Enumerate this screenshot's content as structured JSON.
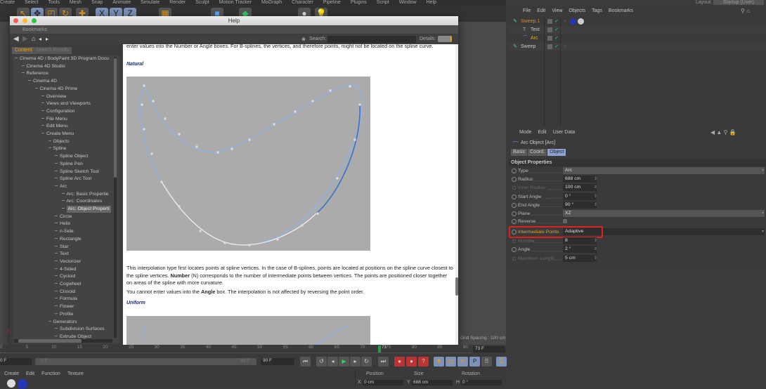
{
  "menubar": [
    "Create",
    "Select",
    "Tools",
    "Mesh",
    "Snap",
    "Animate",
    "Simulate",
    "Render",
    "Sculpt",
    "Motion Tracker",
    "MoGraph",
    "Character",
    "Pipeline",
    "Plugins",
    "Script",
    "Window",
    "Help"
  ],
  "layout": {
    "label": "Layout:",
    "value": "Startup (User)"
  },
  "help": {
    "title": "Help",
    "bookmarks": "Bookmarks",
    "search_label": "Search:",
    "search_value": "",
    "details_label": "Details:",
    "tabs": [
      "Content",
      "Search Results"
    ],
    "tree": [
      {
        "label": "Cinema 4D / BodyPaint 3D Program Docu",
        "level": 0
      },
      {
        "label": "Cinema 4D Studio",
        "level": 1
      },
      {
        "label": "Reference",
        "level": 1
      },
      {
        "label": "Cinema 4D",
        "level": 2
      },
      {
        "label": "Cinema 4D Prime",
        "level": 3
      },
      {
        "label": "Overview",
        "level": 4
      },
      {
        "label": "Views and Viewports",
        "level": 4
      },
      {
        "label": "Configuration",
        "level": 4
      },
      {
        "label": "File Menu",
        "level": 4
      },
      {
        "label": "Edit Menu",
        "level": 4
      },
      {
        "label": "Create Menu",
        "level": 4
      },
      {
        "label": "Objects",
        "level": 5
      },
      {
        "label": "Spline",
        "level": 5
      },
      {
        "label": "Spline Object",
        "level": 6
      },
      {
        "label": "Spline Pen",
        "level": 6
      },
      {
        "label": "Spline Sketch Tool",
        "level": 6
      },
      {
        "label": "Spline Arc Tool",
        "level": 6
      },
      {
        "label": "Arc",
        "level": 6
      },
      {
        "label": "Arc: Basic Propertie",
        "level": 7
      },
      {
        "label": "Arc: Coordinates",
        "level": 7
      },
      {
        "label": "Arc: Object Properti",
        "level": 7,
        "selected": true
      },
      {
        "label": "Circle",
        "level": 6
      },
      {
        "label": "Helix",
        "level": 6
      },
      {
        "label": "n-Side",
        "level": 6
      },
      {
        "label": "Rectangle",
        "level": 6
      },
      {
        "label": "Star",
        "level": 6
      },
      {
        "label": "Text",
        "level": 6
      },
      {
        "label": "Vectorizer",
        "level": 6
      },
      {
        "label": "4-Sided",
        "level": 6
      },
      {
        "label": "Cycloid",
        "level": 6
      },
      {
        "label": "Cogwheel",
        "level": 6
      },
      {
        "label": "Cissoid",
        "level": 6
      },
      {
        "label": "Formula",
        "level": 6
      },
      {
        "label": "Flower",
        "level": 6
      },
      {
        "label": "Profile",
        "level": 6
      },
      {
        "label": "Generators",
        "level": 5
      },
      {
        "label": "Subdivision Surfaces",
        "level": 6
      },
      {
        "label": "Extrude Object",
        "level": 6
      }
    ],
    "content": {
      "intro": "enter values into the Number or Angle boxes. For B-splines, the vertices, and therefore points, might not be located on the spline curve.",
      "natural_heading": "Natural",
      "para1_a": "This interpolation type first locates points at spline vertices. In the case of B-splines, points are located at positions on the spline curve closest to the spline vertices. ",
      "para1_bold": "Number",
      "para1_b": " (N) corresponds to the number of intermediate points between vertices. The points are positioned closer together on areas of the spline with more curvature.",
      "para2_a": "You cannot enter values into the ",
      "para2_bold": "Angle",
      "para2_b": " box. The interpolation is not affected by reversing the point order.",
      "uniform_heading": "Uniform"
    }
  },
  "object_manager": {
    "menu": [
      "File",
      "Edit",
      "View",
      "Objects",
      "Tags",
      "Bookmarks"
    ],
    "objects": [
      {
        "name": "Sweep.1",
        "color": "#d08a2a"
      },
      {
        "name": "Text",
        "color": "#c8c8c8"
      },
      {
        "name": "Arc",
        "color": "#e0b030"
      },
      {
        "name": "Sweep",
        "color": "#c8c8c8"
      }
    ]
  },
  "attributes": {
    "menu": [
      "Mode",
      "Edit",
      "User Data"
    ],
    "title": "Arc Object [Arc]",
    "tabs": [
      "Basic",
      "Coord.",
      "Object"
    ],
    "section": "Object Properties",
    "rows": [
      {
        "label": "Type",
        "value": "Arc",
        "wide": true
      },
      {
        "label": "Radius",
        "value": "688 cm"
      },
      {
        "label": "Inner Radius",
        "value": "100 cm",
        "disabled": true
      },
      {
        "label": "Start Angle",
        "value": "0 °"
      },
      {
        "label": "End Angle",
        "value": "90 °"
      },
      {
        "label": "Plane",
        "value": "XZ",
        "wide": true
      },
      {
        "label": "Reverse",
        "value": "",
        "checkbox": true
      },
      {
        "label": "Intermediate Points",
        "value": "Adaptive",
        "wide": true,
        "highlight": true
      },
      {
        "label": "Number",
        "value": "8",
        "disabled": true
      },
      {
        "label": "Angle",
        "value": "2 °"
      },
      {
        "label": "Maximum Length",
        "value": "5 cm",
        "disabled": true
      }
    ],
    "highlight_color": "#e0201a"
  },
  "viewport": {
    "grid_spacing": "Grid Spacing : 100 cm"
  },
  "timeline": {
    "ticks": [
      "0",
      "5",
      "10",
      "15",
      "20",
      "25",
      "30",
      "35",
      "40",
      "45",
      "50",
      "55",
      "60",
      "65",
      "70",
      "75",
      "80",
      "85",
      "90"
    ],
    "current_frame": "73",
    "current_field": "73 F",
    "start_field": "0 F",
    "range_start": "0 F",
    "range_end": "90 F",
    "end_field": "90 F"
  },
  "bottom": {
    "menu": [
      "Create",
      "Edit",
      "Function",
      "Texture"
    ],
    "coord_headers": [
      "Position",
      "Size",
      "Rotation"
    ],
    "coords": [
      {
        "axis": "X",
        "value": "0 cm"
      },
      {
        "axis": "Y",
        "value": "688 cm"
      },
      {
        "axis": "H",
        "value": "0 °"
      }
    ]
  }
}
